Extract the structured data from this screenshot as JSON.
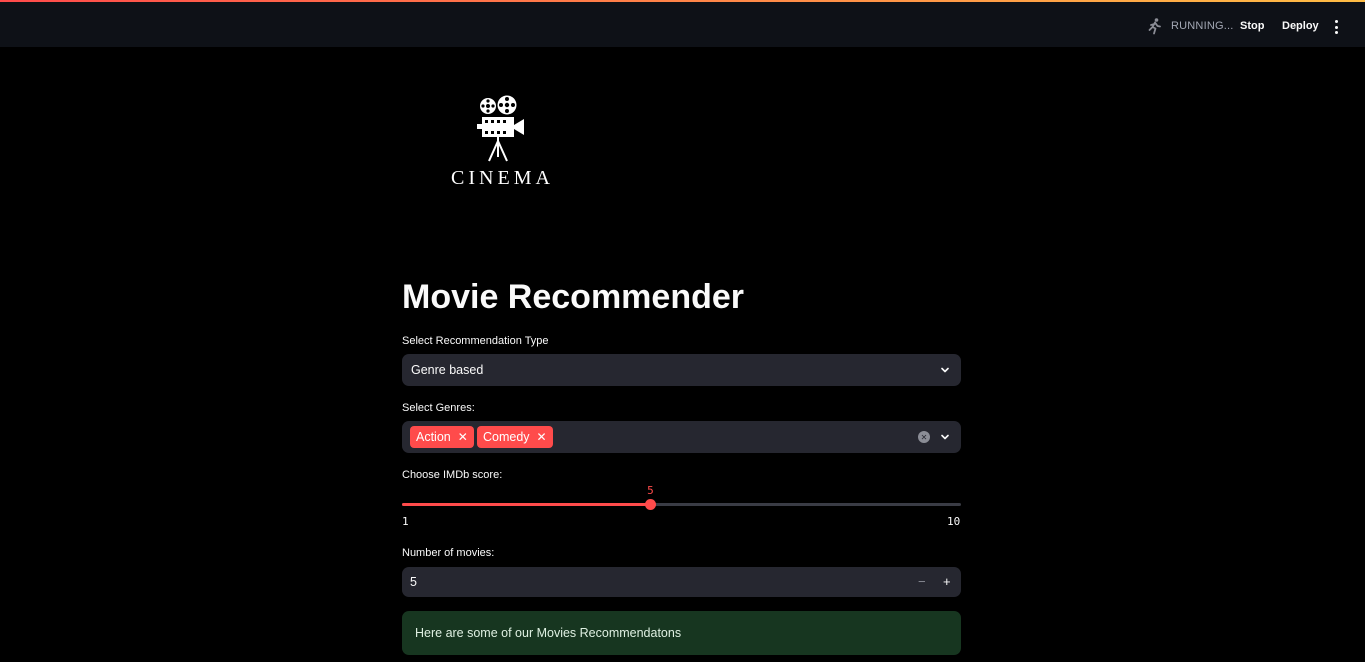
{
  "header": {
    "status_text": "RUNNING...",
    "stop_label": "Stop",
    "deploy_label": "Deploy",
    "status_icon": "running-man-icon",
    "menu_icon": "kebab-menu-icon"
  },
  "logo": {
    "text": "CINEMA",
    "icon": "film-camera-icon"
  },
  "main": {
    "title": "Movie Recommender",
    "recommendation_type": {
      "label": "Select Recommendation Type",
      "value": "Genre based"
    },
    "genres": {
      "label": "Select Genres:",
      "selected": [
        "Action",
        "Comedy"
      ]
    },
    "imdb_score": {
      "label": "Choose IMDb score:",
      "value": "5",
      "min": "1",
      "max": "10",
      "value_num": 5,
      "min_num": 1,
      "max_num": 10
    },
    "num_movies": {
      "label": "Number of movies:",
      "value": "5",
      "minus": "−",
      "plus": "+"
    },
    "success_message": "Here are some of our Movies Recommendatons"
  },
  "colors": {
    "accent": "#ff4b4b",
    "header_bg": "#0e1117",
    "widget_bg": "#262730",
    "success_bg": "#173620"
  }
}
